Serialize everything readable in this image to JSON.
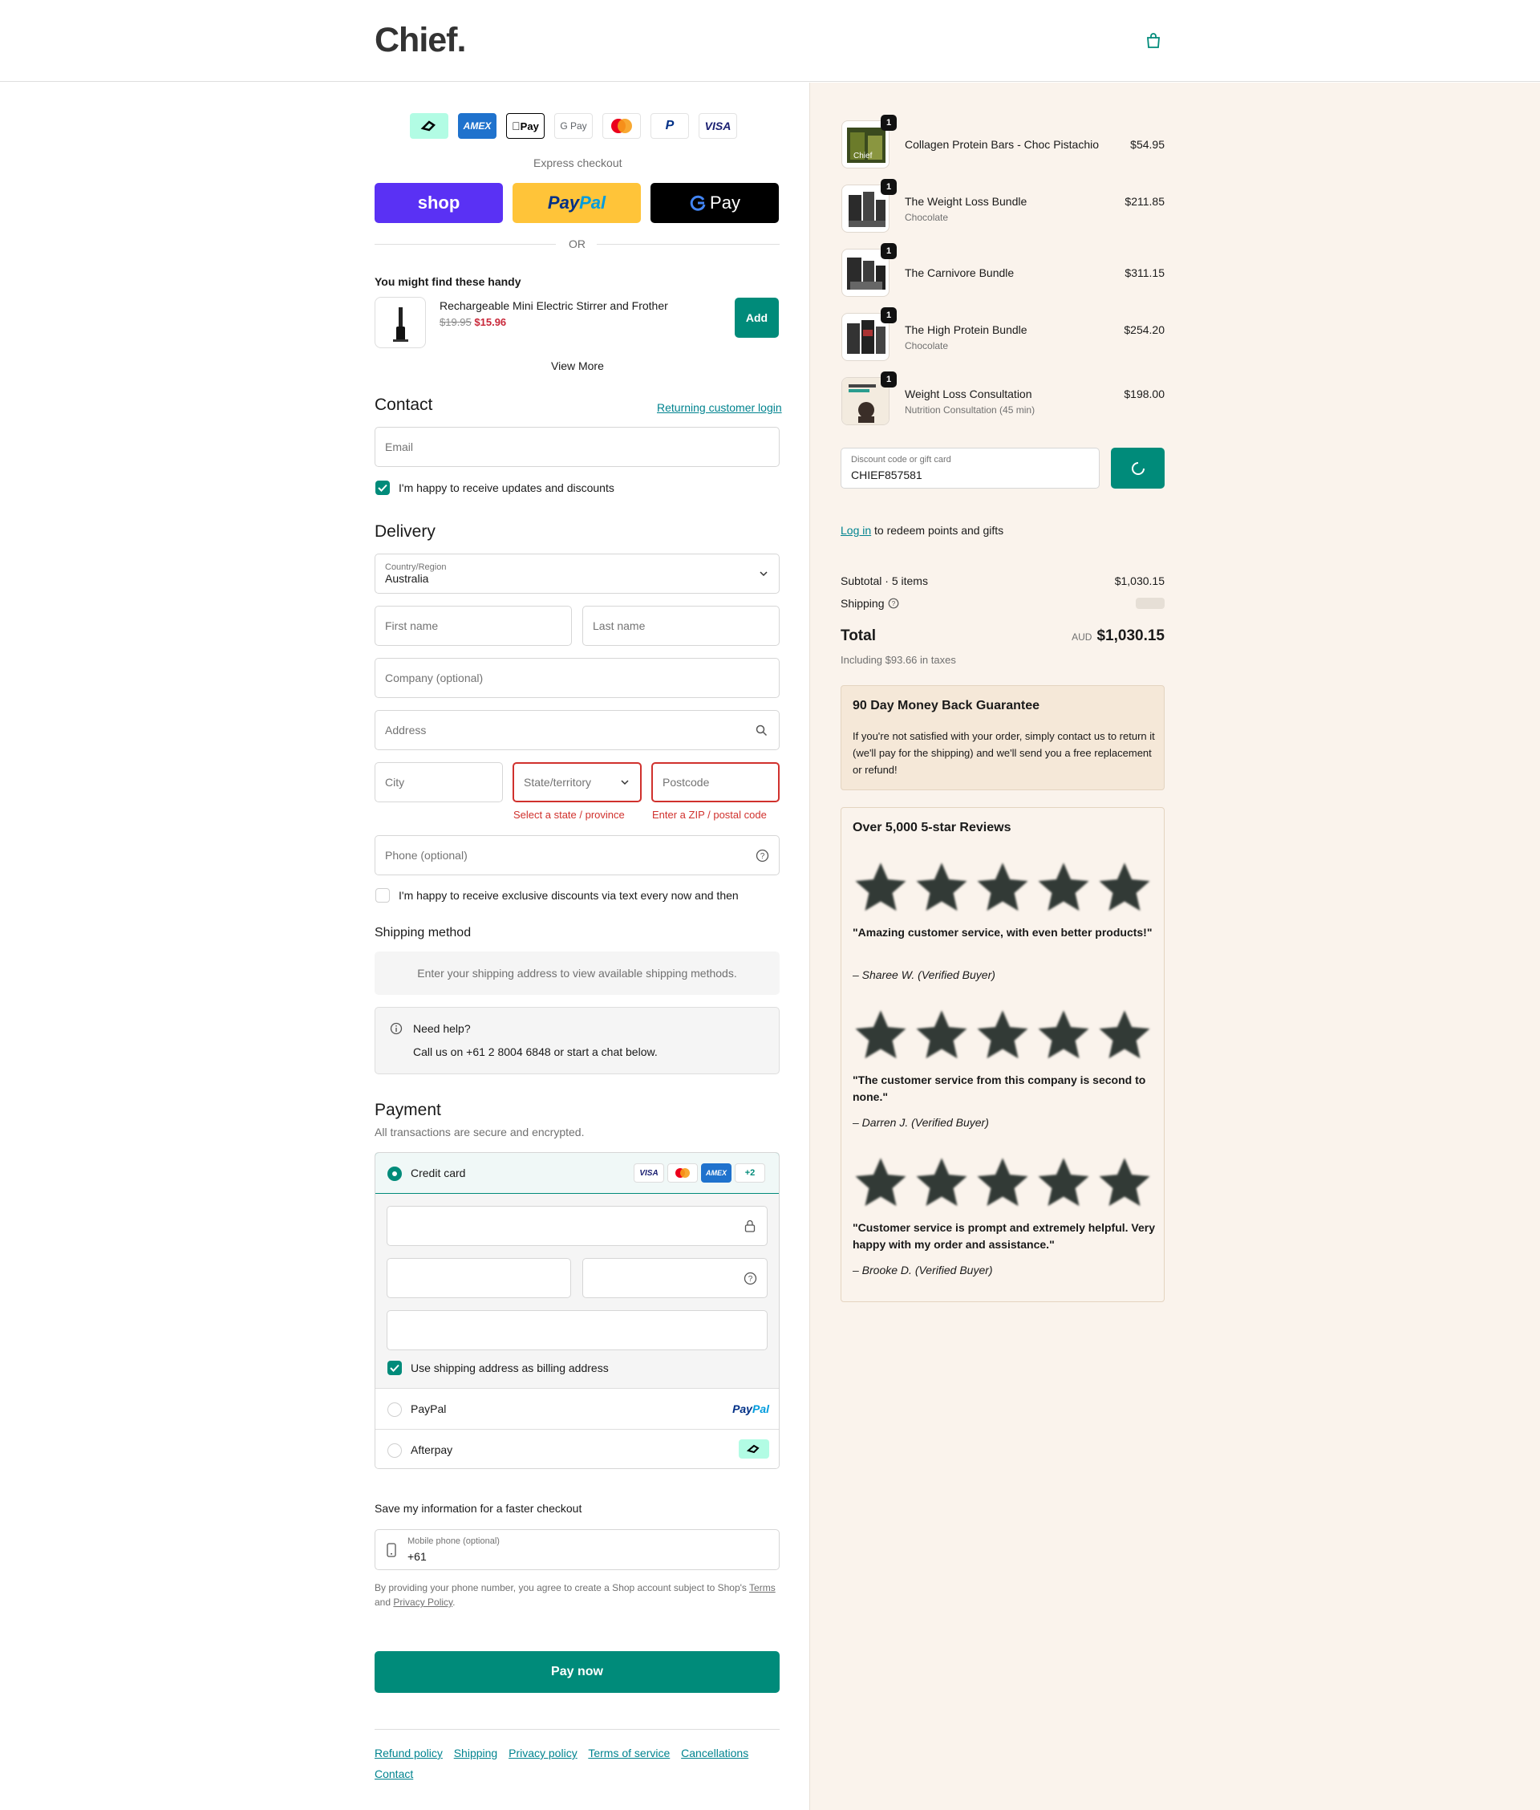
{
  "header": {
    "logo": "Chief.",
    "bag_icon": "shopping-bag-icon"
  },
  "express": {
    "logos": [
      "afterpay",
      "AMEX",
      "Apple Pay",
      "G Pay",
      "mastercard",
      "paypal",
      "VISA"
    ],
    "amex": "AMEX",
    "apple_pay": "Pay",
    "gpay": "G Pay",
    "visa": "VISA",
    "label": "Express checkout",
    "shop": "shop",
    "paypal_pay": "Pay",
    "paypal_pal": "Pal",
    "gpay_btn": "Pay",
    "or": "OR",
    "colors": {
      "shop": "#5a31f4",
      "paypal": "#ffc439",
      "gpay": "#000000"
    }
  },
  "upsell": {
    "heading": "You might find these handy",
    "name": "Rechargeable Mini Electric Stirrer and Frother",
    "old_price": "$19.95",
    "new_price": "$15.96",
    "add": "Add",
    "view_more": "View More"
  },
  "contact": {
    "heading": "Contact",
    "login_link": "Returning customer login",
    "email_placeholder": "Email",
    "updates_label": "I'm happy to receive updates and discounts"
  },
  "delivery": {
    "heading": "Delivery",
    "country_label": "Country/Region",
    "country_value": "Australia",
    "first_name": "First name",
    "last_name": "Last name",
    "company": "Company (optional)",
    "address": "Address",
    "city": "City",
    "state": "State/territory",
    "postcode": "Postcode",
    "state_error": "Select a state / province",
    "postcode_error": "Enter a ZIP / postal code",
    "phone": "Phone (optional)",
    "sms_label": "I'm happy to receive exclusive discounts via text every now and then"
  },
  "shipping": {
    "heading": "Shipping method",
    "notice": "Enter your shipping address to view available shipping methods.",
    "help_title": "Need help?",
    "help_text": "Call us on +61 2 8004 6848 or start a chat below."
  },
  "payment": {
    "heading": "Payment",
    "subtitle": "All transactions are secure and encrypted.",
    "credit_card": "Credit card",
    "card_visa": "VISA",
    "card_amex": "AMEX",
    "more_cards": "+2",
    "billing_label": "Use shipping address as billing address",
    "paypal": "PayPal",
    "paypal_logo_pay": "Pay",
    "paypal_logo_pal": "Pal",
    "afterpay": "Afterpay"
  },
  "save_info": {
    "heading": "Save my information for a faster checkout",
    "phone_label": "Mobile phone (optional)",
    "phone_value": "+61",
    "legal_prefix": "By providing your phone number, you agree to create a Shop account subject to Shop's",
    "terms": "Terms",
    "and": "and",
    "privacy": "Privacy Policy",
    "period": "."
  },
  "pay_now": "Pay now",
  "footer": [
    "Refund policy",
    "Shipping",
    "Privacy policy",
    "Terms of service",
    "Cancellations",
    "Contact"
  ],
  "summary": {
    "items": [
      {
        "name": "Collagen Protein Bars - Choc Pistachio",
        "variant": "",
        "price": "$54.95",
        "qty": "1"
      },
      {
        "name": "The Weight Loss Bundle",
        "variant": "Chocolate",
        "price": "$211.85",
        "qty": "1"
      },
      {
        "name": "The Carnivore Bundle",
        "variant": "",
        "price": "$311.15",
        "qty": "1"
      },
      {
        "name": "The High Protein Bundle",
        "variant": "Chocolate",
        "price": "$254.20",
        "qty": "1"
      },
      {
        "name": "Weight Loss Consultation",
        "variant": "Nutrition Consultation (45 min)",
        "price": "$198.00",
        "qty": "1"
      }
    ],
    "discount_label": "Discount code or gift card",
    "discount_value": "CHIEF857581",
    "login_link": "Log in",
    "login_rest": "to redeem points and gifts",
    "subtotal_label": "Subtotal · 5 items",
    "subtotal": "$1,030.15",
    "shipping_label": "Shipping",
    "total_label": "Total",
    "currency": "AUD",
    "total": "$1,030.15",
    "taxes": "Including $93.66 in taxes"
  },
  "guarantee": {
    "title": "90 Day Money Back Guarantee",
    "text": "If you're not satisfied with your order, simply contact us to return it (we'll pay for the shipping) and we'll send you a free replacement or refund!"
  },
  "reviews": {
    "title": "Over 5,000 5-star Reviews",
    "items": [
      {
        "rating": 5,
        "quote": "\"Amazing customer service, with even better products!\"",
        "author": "– Sharee W. (Verified Buyer)"
      },
      {
        "rating": 5,
        "quote": "\"The customer service from this company is second to none.\"",
        "author": "– Darren J. (Verified Buyer)"
      },
      {
        "rating": 5,
        "quote": "\"Customer service is prompt and extremely helpful. Very happy with my order and assistance.\"",
        "author": "– Brooke D. (Verified Buyer)"
      }
    ]
  },
  "colors": {
    "accent": "#008b7a",
    "error": "#d0312d",
    "link": "#00838f",
    "summary_bg": "#faf3ec"
  }
}
